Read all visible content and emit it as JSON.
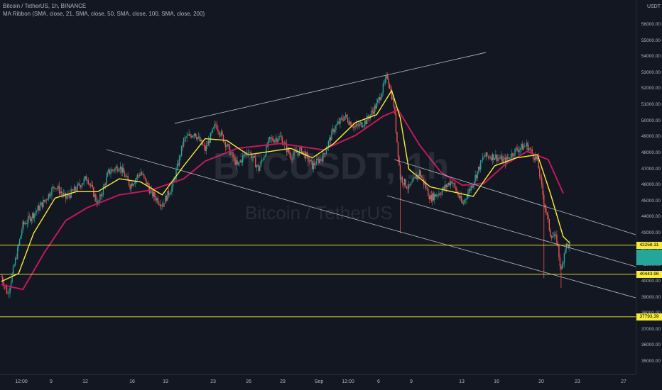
{
  "legend": {
    "symbol_line": "Bitcoin / TetherUS, 1h, BINANCE",
    "indicator_line": "MA Ribbon (SMA, close, 21, SMA, close, 50, SMA, close, 100, SMA, close, 200)"
  },
  "watermark": {
    "ticker": "BTCUSDT, 1h",
    "name": "Bitcoin / TetherUS"
  },
  "price_scale": {
    "currency": "USDT",
    "ticks": [
      "56000.00",
      "55000.00",
      "54000.00",
      "53000.00",
      "52000.00",
      "51000.00",
      "50000.00",
      "49000.00",
      "48000.00",
      "47000.00",
      "46000.00",
      "45000.00",
      "44000.00",
      "43000.00",
      "42000.00",
      "41000.00",
      "40000.00",
      "39000.00",
      "38000.00",
      "37000.00",
      "36000.00",
      "35000.00"
    ]
  },
  "price_tags": [
    {
      "label": "42258.31",
      "color": "#f7ec3b"
    },
    {
      "label": "",
      "color": "#26a69a"
    },
    {
      "label": "40443.98",
      "color": "#f7ec3b"
    },
    {
      "label": "37793.39",
      "color": "#f7ec3b"
    }
  ],
  "time_scale": {
    "labels": [
      "12:00",
      "9",
      "12",
      "16",
      "19",
      "23",
      "26",
      "29",
      "Sep",
      "12:00",
      "6",
      "9",
      "13",
      "16",
      "20",
      "23",
      "27"
    ]
  },
  "colors": {
    "background": "#131722",
    "up_candle": "#26a69a",
    "down_candle": "#ef5350",
    "ma_fast": "#ffeb3b",
    "ma_slow": "#c2185b",
    "horizontal_lines": "#f7ec3b",
    "trend_lines": "#d1d4dc"
  },
  "chart_data": {
    "type": "line",
    "symbol": "BTCUSDT",
    "interval": "1h",
    "price_range": [
      35000,
      57000
    ],
    "horizontal_levels": [
      42258.31,
      40443.98,
      37793.39
    ],
    "close_path": [
      {
        "t": 0,
        "p": 40300
      },
      {
        "t": 3,
        "p": 39200
      },
      {
        "t": 6,
        "p": 41000
      },
      {
        "t": 10,
        "p": 43500
      },
      {
        "t": 15,
        "p": 44200
      },
      {
        "t": 20,
        "p": 45000
      },
      {
        "t": 25,
        "p": 46000
      },
      {
        "t": 30,
        "p": 45200
      },
      {
        "t": 35,
        "p": 45800
      },
      {
        "t": 40,
        "p": 46500
      },
      {
        "t": 45,
        "p": 44800
      },
      {
        "t": 50,
        "p": 46800
      },
      {
        "t": 55,
        "p": 47200
      },
      {
        "t": 60,
        "p": 46000
      },
      {
        "t": 65,
        "p": 46800
      },
      {
        "t": 70,
        "p": 45500
      },
      {
        "t": 75,
        "p": 44800
      },
      {
        "t": 80,
        "p": 46000
      },
      {
        "t": 85,
        "p": 48800
      },
      {
        "t": 90,
        "p": 49300
      },
      {
        "t": 95,
        "p": 48200
      },
      {
        "t": 100,
        "p": 49800
      },
      {
        "t": 105,
        "p": 48500
      },
      {
        "t": 110,
        "p": 47200
      },
      {
        "t": 115,
        "p": 48200
      },
      {
        "t": 120,
        "p": 47000
      },
      {
        "t": 125,
        "p": 48800
      },
      {
        "t": 130,
        "p": 49000
      },
      {
        "t": 135,
        "p": 47800
      },
      {
        "t": 140,
        "p": 48200
      },
      {
        "t": 145,
        "p": 47200
      },
      {
        "t": 150,
        "p": 47800
      },
      {
        "t": 155,
        "p": 49500
      },
      {
        "t": 160,
        "p": 50300
      },
      {
        "t": 165,
        "p": 49600
      },
      {
        "t": 170,
        "p": 50000
      },
      {
        "t": 175,
        "p": 51000
      },
      {
        "t": 180,
        "p": 52800
      },
      {
        "t": 183,
        "p": 51000
      },
      {
        "t": 186,
        "p": 46500
      },
      {
        "t": 190,
        "p": 45800
      },
      {
        "t": 195,
        "p": 46800
      },
      {
        "t": 200,
        "p": 45200
      },
      {
        "t": 205,
        "p": 45600
      },
      {
        "t": 210,
        "p": 46300
      },
      {
        "t": 215,
        "p": 44800
      },
      {
        "t": 220,
        "p": 46200
      },
      {
        "t": 225,
        "p": 47800
      },
      {
        "t": 230,
        "p": 47800
      },
      {
        "t": 235,
        "p": 47500
      },
      {
        "t": 240,
        "p": 48200
      },
      {
        "t": 245,
        "p": 48500
      },
      {
        "t": 250,
        "p": 47500
      },
      {
        "t": 253,
        "p": 45000
      },
      {
        "t": 256,
        "p": 43000
      },
      {
        "t": 259,
        "p": 42600
      },
      {
        "t": 261,
        "p": 40600
      },
      {
        "t": 263,
        "p": 42200
      },
      {
        "t": 265,
        "p": 42258
      }
    ],
    "ma_fast": [
      {
        "t": 0,
        "p": 40000
      },
      {
        "t": 8,
        "p": 40500
      },
      {
        "t": 15,
        "p": 43000
      },
      {
        "t": 25,
        "p": 45200
      },
      {
        "t": 35,
        "p": 45600
      },
      {
        "t": 45,
        "p": 45600
      },
      {
        "t": 55,
        "p": 46400
      },
      {
        "t": 65,
        "p": 46200
      },
      {
        "t": 75,
        "p": 45400
      },
      {
        "t": 85,
        "p": 47200
      },
      {
        "t": 95,
        "p": 48900
      },
      {
        "t": 105,
        "p": 48800
      },
      {
        "t": 115,
        "p": 47900
      },
      {
        "t": 125,
        "p": 48100
      },
      {
        "t": 135,
        "p": 48300
      },
      {
        "t": 145,
        "p": 47700
      },
      {
        "t": 155,
        "p": 48600
      },
      {
        "t": 165,
        "p": 49900
      },
      {
        "t": 175,
        "p": 50400
      },
      {
        "t": 182,
        "p": 51900
      },
      {
        "t": 186,
        "p": 50200
      },
      {
        "t": 190,
        "p": 47000
      },
      {
        "t": 200,
        "p": 45900
      },
      {
        "t": 210,
        "p": 45600
      },
      {
        "t": 220,
        "p": 45300
      },
      {
        "t": 230,
        "p": 47200
      },
      {
        "t": 240,
        "p": 47700
      },
      {
        "t": 250,
        "p": 47900
      },
      {
        "t": 256,
        "p": 45500
      },
      {
        "t": 262,
        "p": 42800
      },
      {
        "t": 265,
        "p": 42400
      }
    ],
    "ma_slow": [
      {
        "t": 0,
        "p": 39800
      },
      {
        "t": 10,
        "p": 39500
      },
      {
        "t": 20,
        "p": 41800
      },
      {
        "t": 30,
        "p": 43800
      },
      {
        "t": 40,
        "p": 44600
      },
      {
        "t": 55,
        "p": 45400
      },
      {
        "t": 70,
        "p": 45700
      },
      {
        "t": 85,
        "p": 46400
      },
      {
        "t": 95,
        "p": 47500
      },
      {
        "t": 110,
        "p": 48300
      },
      {
        "t": 130,
        "p": 48600
      },
      {
        "t": 150,
        "p": 48200
      },
      {
        "t": 165,
        "p": 49100
      },
      {
        "t": 178,
        "p": 50300
      },
      {
        "t": 185,
        "p": 50700
      },
      {
        "t": 195,
        "p": 48500
      },
      {
        "t": 205,
        "p": 46800
      },
      {
        "t": 215,
        "p": 46000
      },
      {
        "t": 225,
        "p": 46100
      },
      {
        "t": 235,
        "p": 47300
      },
      {
        "t": 245,
        "p": 48100
      },
      {
        "t": 255,
        "p": 47600
      },
      {
        "t": 262,
        "p": 45500
      }
    ]
  }
}
